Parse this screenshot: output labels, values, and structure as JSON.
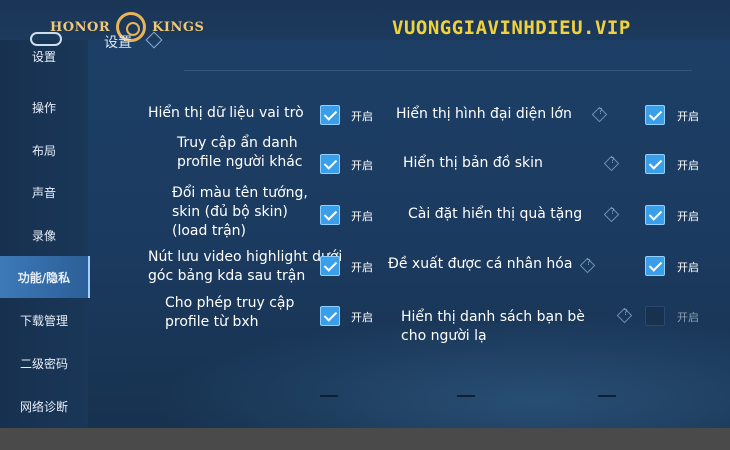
{
  "header": {
    "brand_left": "HONOR",
    "brand_right": "KINGS",
    "watermark": "VUONGGIAVINHDIEU.VIP",
    "title": "设置"
  },
  "sidebar": {
    "items": [
      {
        "label": "设置",
        "active": false
      },
      {
        "label": "操作",
        "active": false
      },
      {
        "label": "布局",
        "active": false
      },
      {
        "label": "声音",
        "active": false
      },
      {
        "label": "录像",
        "active": false
      },
      {
        "label": "功能/隐私",
        "active": true
      },
      {
        "label": "下载管理",
        "active": false
      },
      {
        "label": "二级密码",
        "active": false
      },
      {
        "label": "网络诊断",
        "active": false
      }
    ]
  },
  "settings": {
    "on_text": "开启",
    "left": [
      {
        "label": "Hiển thị dữ liệu vai trò",
        "checked": true
      },
      {
        "label": "Truy cập ẩn danh profile người khác",
        "checked": true
      },
      {
        "label": "Đổi màu tên tướng, skin (đủ bộ skin) (load trận)",
        "checked": true
      },
      {
        "label": "Nút lưu video highlight dưới góc bảng kda sau trận",
        "checked": true
      },
      {
        "label": "Cho phép truy cập profile từ bxh",
        "checked": true
      }
    ],
    "right": [
      {
        "label": "Hiển thị hình đại diện lớn",
        "checked": true
      },
      {
        "label": "Hiển thị bản đồ skin",
        "checked": true
      },
      {
        "label": "Cài đặt hiển thị quà tặng",
        "checked": true
      },
      {
        "label": "Đề xuất được cá nhân hóa",
        "checked": true
      },
      {
        "label": "Hiển thị danh sách bạn bè cho người lạ",
        "checked": false
      }
    ]
  },
  "colors": {
    "accent": "#3a9ee8",
    "active_tab": "#3d79b8",
    "watermark": "#f2d23a",
    "brand": "#f0c878"
  }
}
